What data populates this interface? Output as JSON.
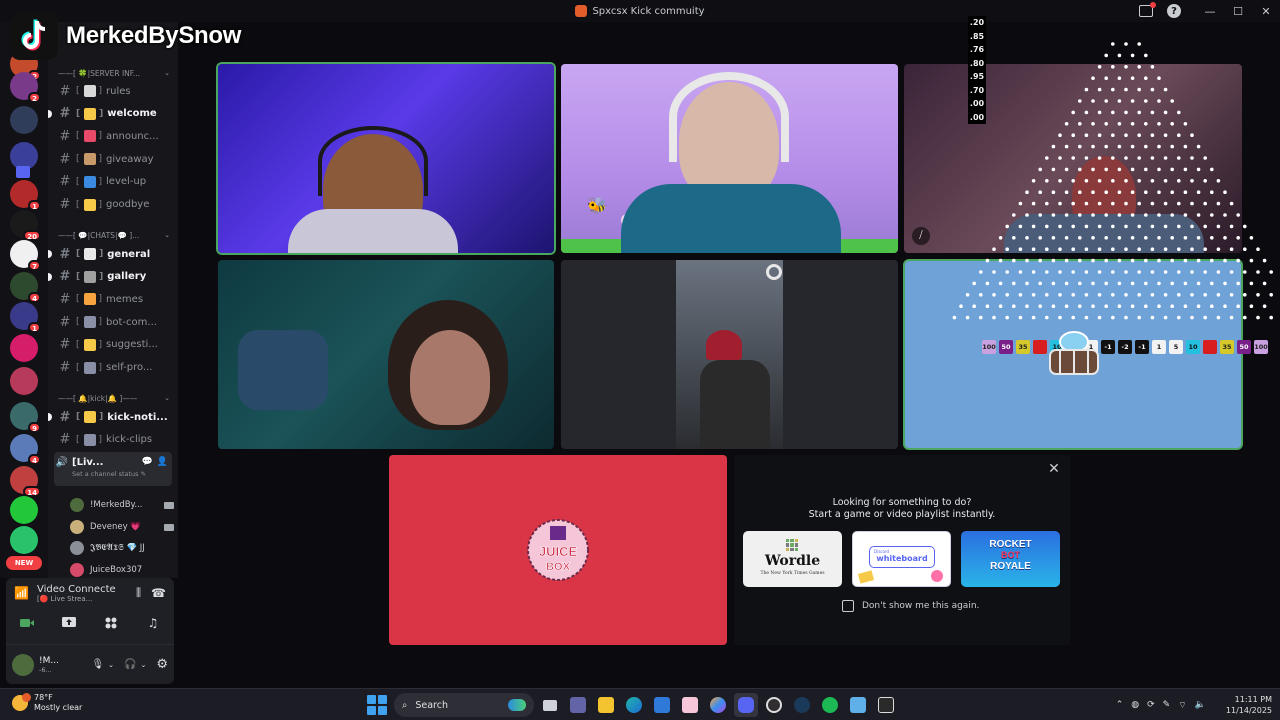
{
  "window": {
    "title": "Spxcsx Kick commuity"
  },
  "watermark": {
    "name": "MerkedBySnow"
  },
  "servers": [
    {
      "badge": "2",
      "color": "#c44b2b"
    },
    {
      "badge": "2",
      "color": "#7a3a8a"
    },
    {
      "badge": "",
      "color": "#2f3d5a"
    },
    {
      "badge": "",
      "color": "#3a3f9a"
    },
    {
      "badge": "1",
      "color": "#b32a2a"
    },
    {
      "badge": "20",
      "color": "#1a1a1a"
    },
    {
      "badge": "7",
      "color": "#f0f0f0"
    },
    {
      "badge": "4",
      "color": "#2e4a2e"
    },
    {
      "badge": "1",
      "color": "#3a3a8a"
    },
    {
      "badge": "",
      "color": "#d61d6a"
    },
    {
      "badge": "",
      "color": "#b83a5a"
    },
    {
      "badge": "9",
      "color": "#3a6a6a"
    },
    {
      "badge": "4",
      "color": "#5a7ab8"
    },
    {
      "badge": "14",
      "color": "#c04040"
    },
    {
      "badge": "",
      "color": "#22c83a"
    },
    {
      "badge": "",
      "color": "#2ac26a"
    }
  ],
  "new_label": "NEW",
  "channels": {
    "cat_server_info": "——[ 🍀|SERVER INF...",
    "cat_chats": "——[ 💬|CHATS|💬 ]...",
    "cat_kick": "——[ 🔔|kick|🔔 ]——",
    "items": [
      {
        "name": "rules",
        "bold": false
      },
      {
        "name": "welcome",
        "bold": true
      },
      {
        "name": "announc...",
        "bold": false
      },
      {
        "name": "giveaway",
        "bold": false
      },
      {
        "name": "level-up",
        "bold": false
      },
      {
        "name": "goodbye",
        "bold": false
      },
      {
        "name": "general",
        "bold": true
      },
      {
        "name": "gallery",
        "bold": true
      },
      {
        "name": "memes",
        "bold": false
      },
      {
        "name": "bot-com...",
        "bold": false
      },
      {
        "name": "suggesti...",
        "bold": false
      },
      {
        "name": "self-pro...",
        "bold": false
      },
      {
        "name": "kick-noti...",
        "bold": true
      },
      {
        "name": "kick-clips",
        "bold": false
      }
    ],
    "voice_channel": {
      "name": "Liv...",
      "status": "Set a channel status"
    },
    "voice_members": [
      {
        "name": "!MerkedBy...",
        "color": "#4d6b3c",
        "cam": true
      },
      {
        "name": "Deveney 💗",
        "color": "#c9b07a",
        "cam": true
      },
      {
        "name": "𝕵𝕭𝕰𝕬𝕿𝕾 💎 JJ",
        "color": "#8a8f98",
        "cam": false
      },
      {
        "name": "JuiceBox307",
        "color": "#d64a6a",
        "cam": false
      }
    ]
  },
  "voice_panel": {
    "title": "Video Connecte",
    "sub": "[🔴 Live Strea..."
  },
  "user_panel": {
    "name": "!M...",
    "sub": "-6..."
  },
  "tiles": [
    {
      "id": "tile-1",
      "speaking": true
    },
    {
      "id": "tile-2",
      "speaking": false
    },
    {
      "id": "tile-3",
      "speaking": false
    },
    {
      "id": "tile-4",
      "speaking": false
    },
    {
      "id": "tile-5",
      "speaking": false
    },
    {
      "id": "tile-6",
      "speaking": true
    }
  ],
  "multipliers": [
    ".20",
    ".85",
    ".76",
    ".80",
    ".95",
    ".70",
    ".00",
    ".00"
  ],
  "plinko_slots": [
    {
      "v": "100",
      "bg": "#c9a0e0",
      "fg": "#222"
    },
    {
      "v": "50",
      "bg": "#7a1e8a",
      "fg": "#fff"
    },
    {
      "v": "35",
      "bg": "#d4c82a",
      "fg": "#222"
    },
    {
      "v": "20",
      "bg": "#d81e1e",
      "fg": "#d81e1e"
    },
    {
      "v": "10",
      "bg": "#24c0e0",
      "fg": "#111"
    },
    {
      "v": "5",
      "bg": "#f2f2f2",
      "fg": "#111"
    },
    {
      "v": "1",
      "bg": "#f2f2f2",
      "fg": "#111"
    },
    {
      "v": "-1",
      "bg": "#111",
      "fg": "#fff"
    },
    {
      "v": "-2",
      "bg": "#111",
      "fg": "#fff"
    },
    {
      "v": "-1",
      "bg": "#111",
      "fg": "#fff"
    },
    {
      "v": "1",
      "bg": "#f2f2f2",
      "fg": "#111"
    },
    {
      "v": "5",
      "bg": "#f2f2f2",
      "fg": "#111"
    },
    {
      "v": "10",
      "bg": "#24c0e0",
      "fg": "#111"
    },
    {
      "v": "20",
      "bg": "#d81e1e",
      "fg": "#d81e1e"
    },
    {
      "v": "35",
      "bg": "#d4c82a",
      "fg": "#222"
    },
    {
      "v": "50",
      "bg": "#7a1e8a",
      "fg": "#fff"
    },
    {
      "v": "100",
      "bg": "#c9a0e0",
      "fg": "#222"
    }
  ],
  "activity": {
    "heading_line1": "Looking for something to do?",
    "heading_line2": "Start a game or video playlist instantly.",
    "wordle_title": "Wordle",
    "wordle_sub": "The New York Times Games",
    "whiteboard_top": "Discord",
    "whiteboard_title": "whiteboard",
    "rocket_line1": "ROCKET",
    "rocket_line2": "BOT",
    "rocket_line3": "ROYALE",
    "dont_show": "Don't show me this again.",
    "juicebox_line1": "JUICE",
    "juicebox_line2": "BOX"
  },
  "taskbar": {
    "temperature": "78°F",
    "weather": "Mostly clear",
    "search_placeholder": "Search",
    "time": "11:11 PM",
    "date": "11/14/2025"
  }
}
